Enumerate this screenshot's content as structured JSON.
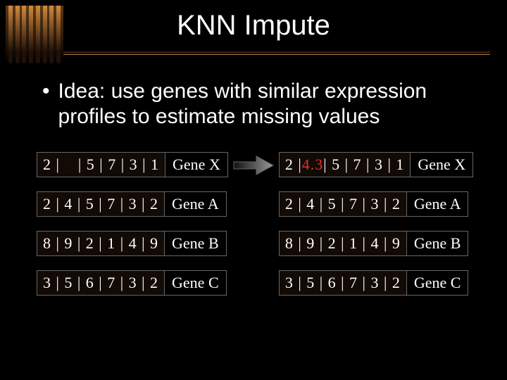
{
  "title": "KNN Impute",
  "bullet": "Idea: use genes with similar expression profiles to estimate missing values",
  "left": {
    "rows": [
      {
        "values": "2 |    | 5 | 7 | 3 | 1",
        "label": "Gene X"
      },
      {
        "values": "2 | 4 | 5 | 7 | 3 | 2",
        "label": "Gene A"
      },
      {
        "values": "8 | 9 | 2 | 1 | 4 | 9",
        "label": "Gene B"
      },
      {
        "values": "3 | 5 | 6 | 7 | 3 | 2",
        "label": "Gene C"
      }
    ]
  },
  "right": {
    "rows": [
      {
        "prefix": "2 |",
        "imputed": "4.3",
        "suffix": "| 5 | 7 | 3 | 1",
        "label": "Gene X"
      },
      {
        "values": "2 | 4 | 5 | 7 | 3 | 2",
        "label": "Gene A"
      },
      {
        "values": "8 | 9 | 2 | 1 | 4 | 9",
        "label": "Gene B"
      },
      {
        "values": "3 | 5 | 6 | 7 | 3 | 2",
        "label": "Gene C"
      }
    ]
  }
}
